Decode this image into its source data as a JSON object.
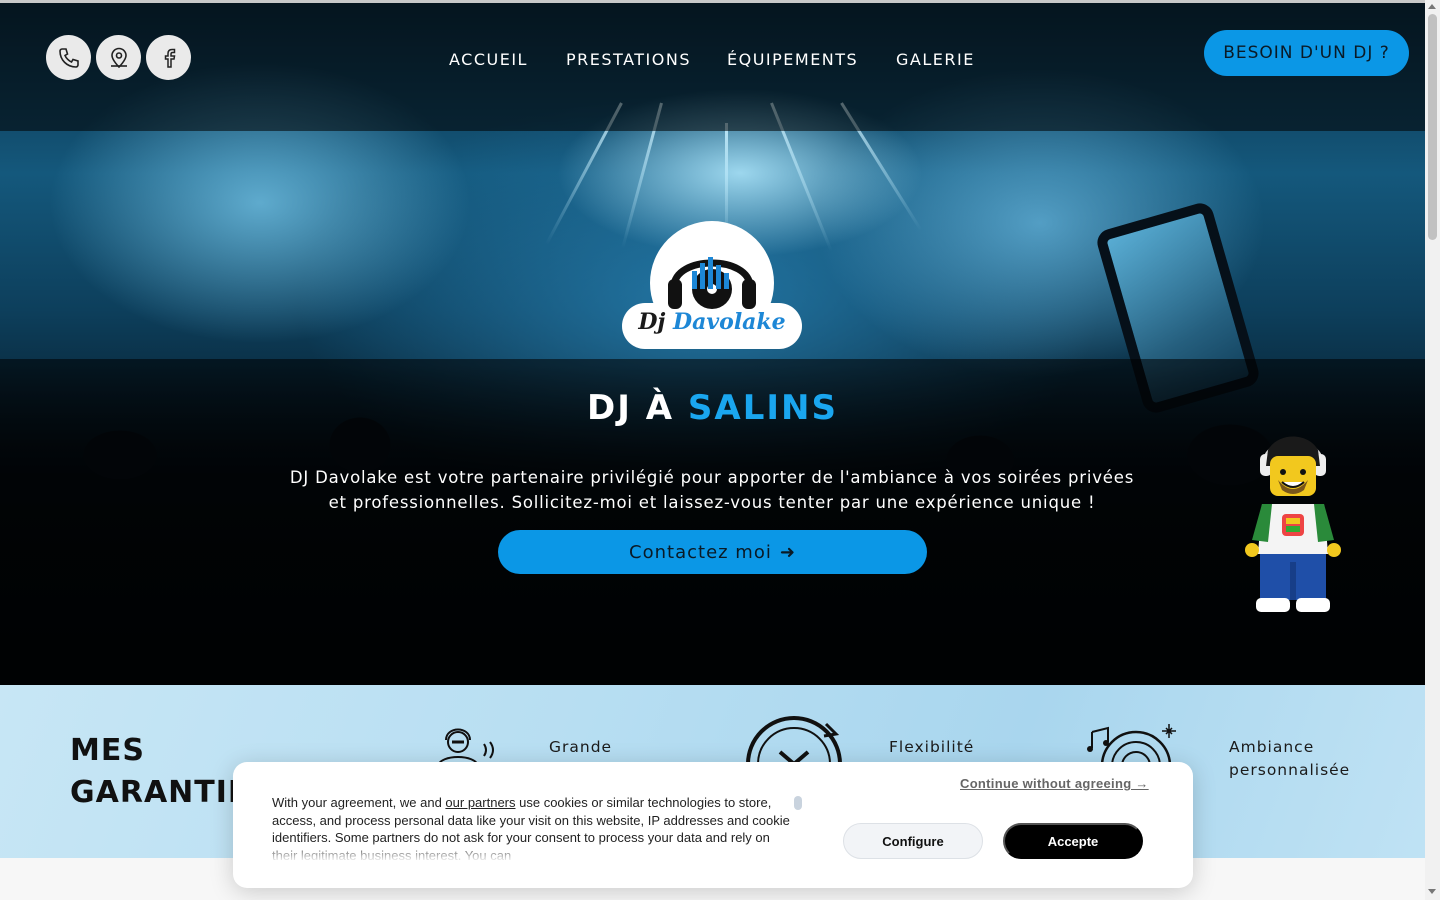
{
  "nav": {
    "social": [
      {
        "icon": "phone-icon"
      },
      {
        "icon": "map-pin-icon"
      },
      {
        "icon": "facebook-icon"
      }
    ],
    "links": [
      "ACCUEIL",
      "PRESTATIONS",
      "ÉQUIPEMENTS",
      "GALERIE"
    ],
    "cta": "BESOIN D'UN DJ ?"
  },
  "logo": {
    "prefix": "Dj",
    "name": "Davolake"
  },
  "hero": {
    "title_start": "DJ À",
    "title_accent": "SALINS",
    "text": "DJ Davolake est votre partenaire privilégié pour apporter de l'ambiance à vos soirées privées et professionnelles. Sollicitez-moi et laissez-vous tenter par une expérience unique !",
    "button": "Contactez moi",
    "button_arrow": "➜"
  },
  "guarantees": {
    "title_line1": "MES",
    "title_line2": "GARANTIES",
    "items": [
      {
        "label": "Grande",
        "icon": "dj-icon"
      },
      {
        "label": "Flexibilité",
        "icon": "clock-icon"
      },
      {
        "label": "Ambiance personnalisée",
        "icon": "vinyl-music-icon"
      }
    ]
  },
  "cookie": {
    "skip": "Continue without agreeing →",
    "text_before": "With your agreement, we and ",
    "partners_link": "our partners",
    "text_after": " use cookies or similar technologies to store, access, and process personal data like your visit on this website, IP addresses and cookie identifiers. Some partners do not ask for your consent to process your data and rely on their legitimate business interest. You can",
    "configure": "Configure",
    "accept": "Accepte"
  },
  "colors": {
    "accent": "#0b97e6",
    "title_accent": "#1aa6ef",
    "guarantee_bg": "#b7def2"
  }
}
